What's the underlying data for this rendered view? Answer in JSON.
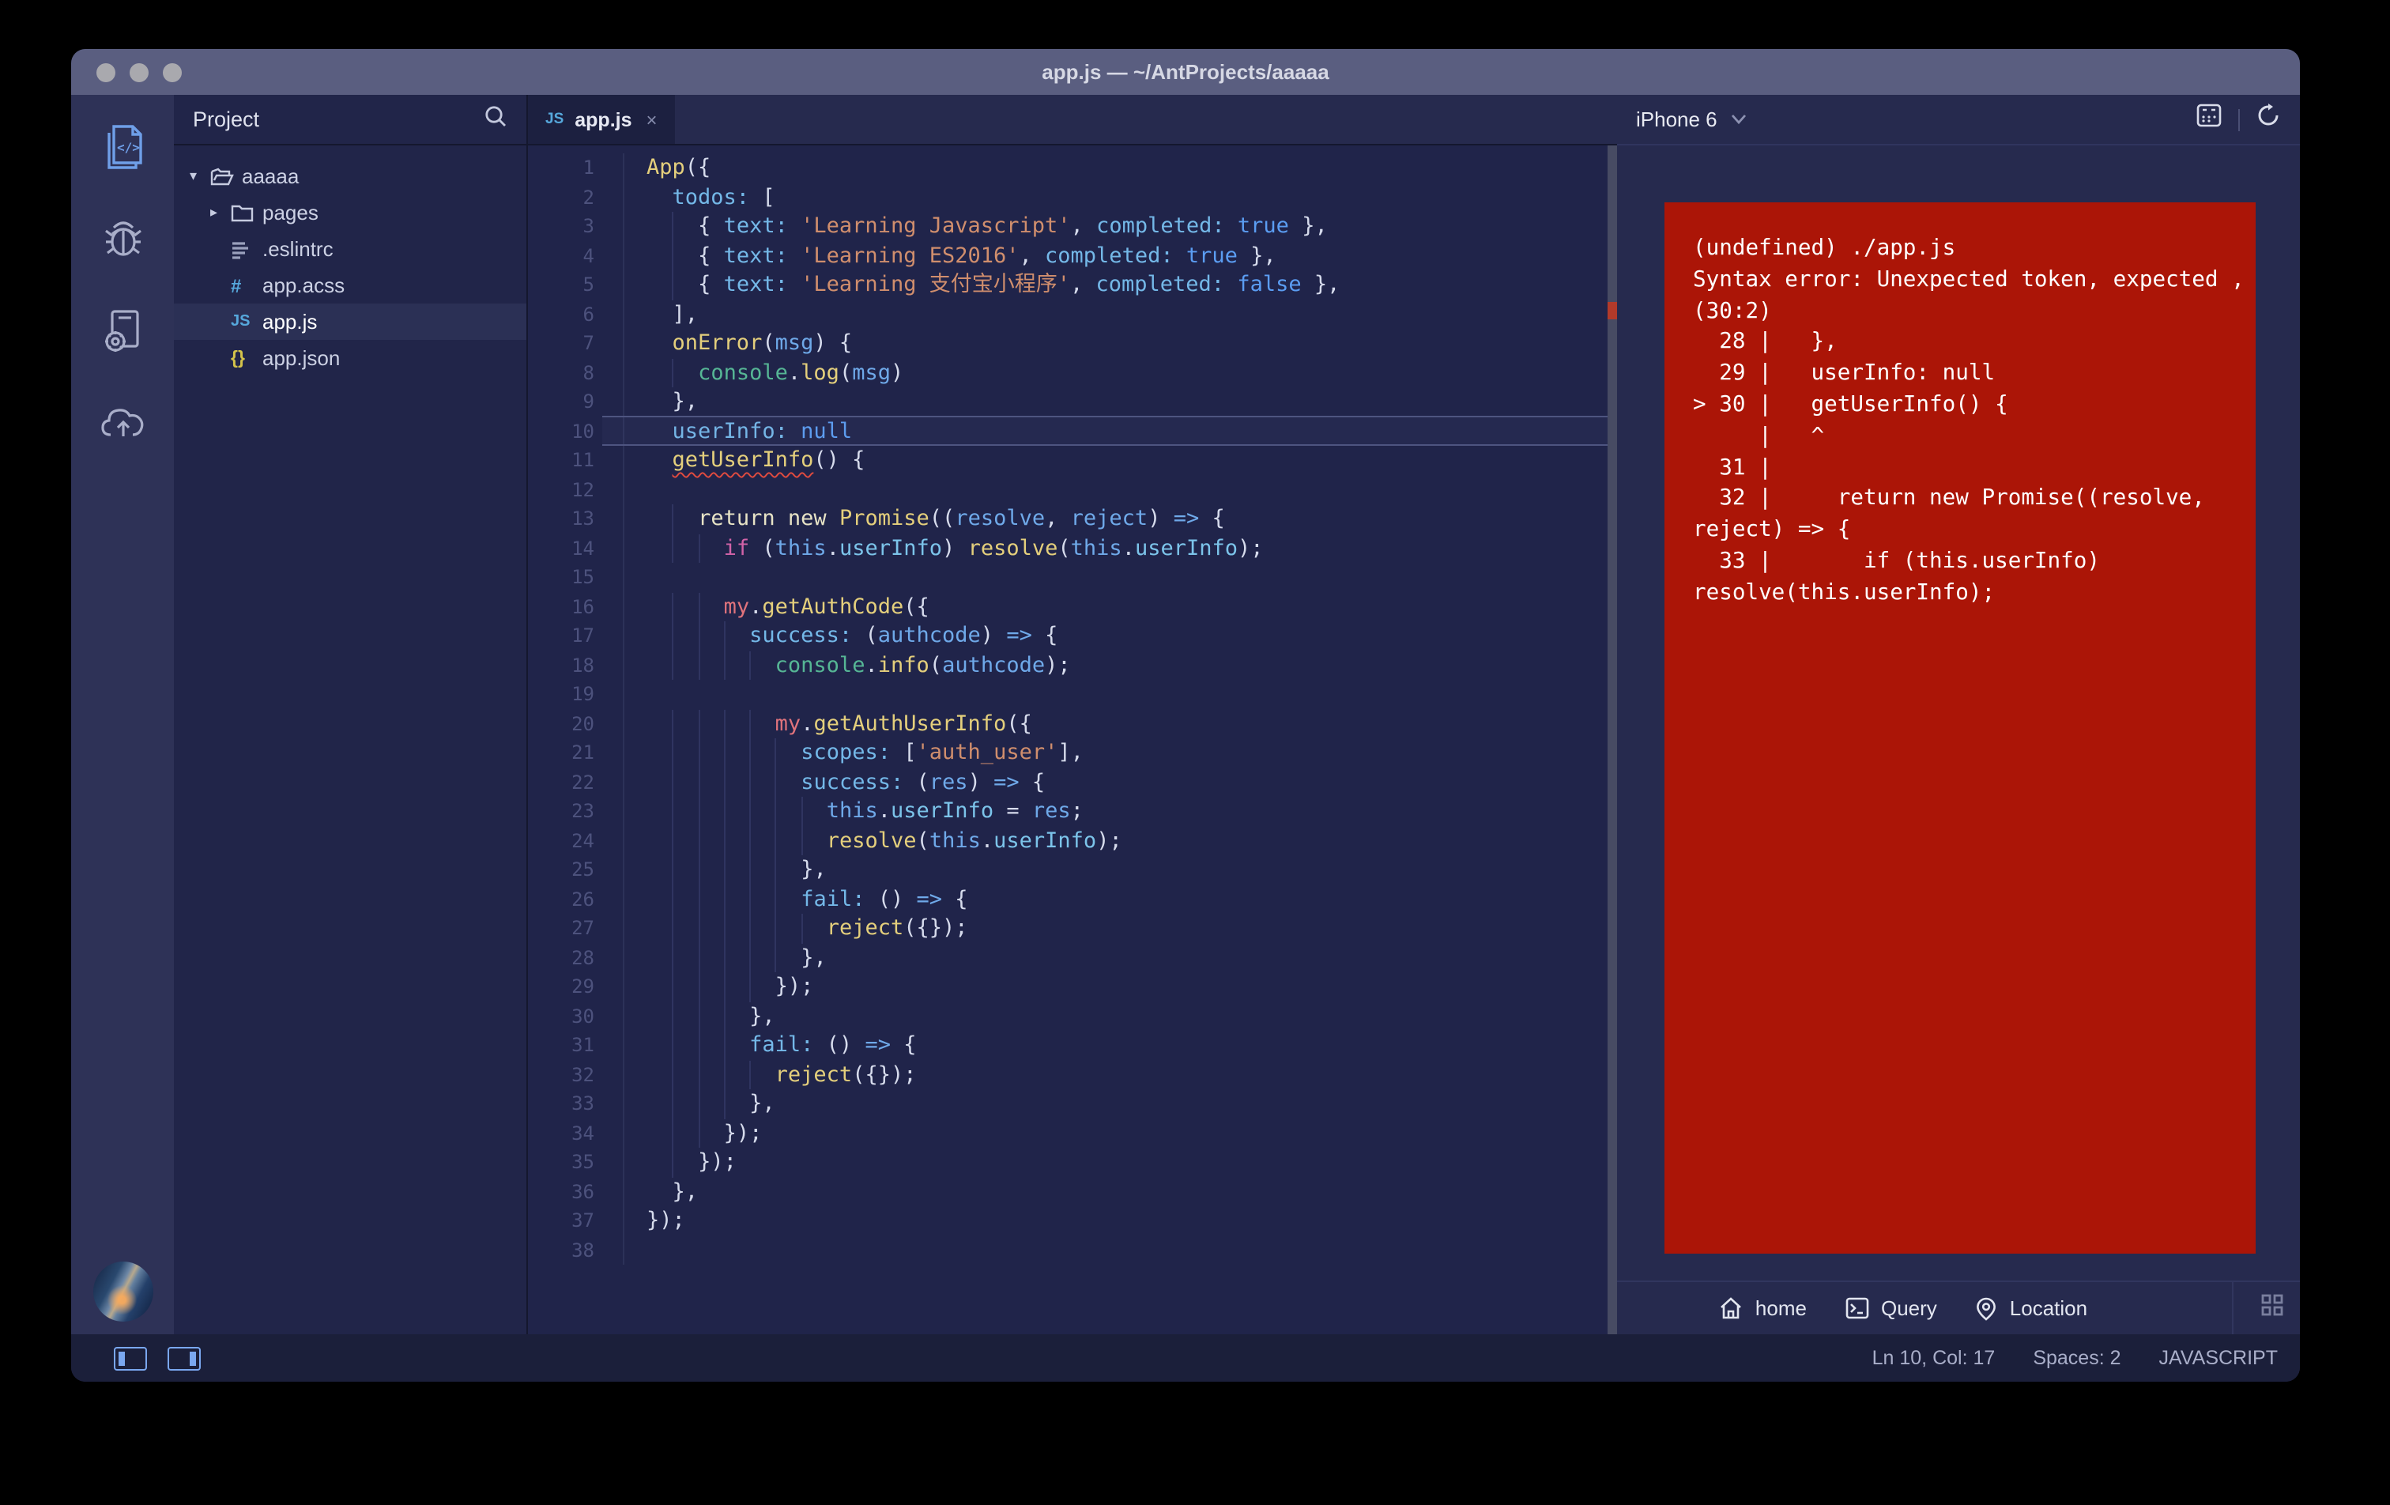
{
  "window": {
    "title": "app.js — ~/AntProjects/aaaaa"
  },
  "colors": {
    "error_screen": "#ab1507",
    "accent_blue": "#6f9fe8",
    "titlebar": "#5a5e80"
  },
  "activity_bar": {
    "icons": [
      {
        "name": "code-file",
        "active": true
      },
      {
        "name": "debug-bug",
        "active": false
      },
      {
        "name": "device-settings",
        "active": false
      },
      {
        "name": "cloud-upload",
        "active": false
      }
    ]
  },
  "sidebar": {
    "header": "Project",
    "items": [
      {
        "icon": "folder-open",
        "caret": "▾",
        "label": "aaaaa",
        "indent": 0,
        "selected": false
      },
      {
        "icon": "folder",
        "caret": "▸",
        "label": "pages",
        "indent": 1,
        "selected": false
      },
      {
        "icon": "eslint",
        "caret": "",
        "label": ".eslintrc",
        "indent": 1,
        "selected": false
      },
      {
        "icon": "acss",
        "caret": "",
        "label": "app.acss",
        "indent": 1,
        "selected": false
      },
      {
        "icon": "js",
        "caret": "",
        "label": "app.js",
        "indent": 1,
        "selected": true
      },
      {
        "icon": "json",
        "caret": "",
        "label": "app.json",
        "indent": 1,
        "selected": false
      }
    ]
  },
  "editor": {
    "tab": {
      "badge": "JS",
      "label": "app.js",
      "close": "×"
    },
    "lines": [
      {
        "n": 1,
        "indent": 0,
        "t": [
          [
            "fn",
            "App"
          ],
          [
            "p",
            "({"
          ]
        ]
      },
      {
        "n": 2,
        "indent": 2,
        "t": [
          [
            "key",
            "todos:"
          ],
          [
            "p",
            " ["
          ]
        ]
      },
      {
        "n": 3,
        "indent": 4,
        "t": [
          [
            "p",
            "{ "
          ],
          [
            "key",
            "text:"
          ],
          [
            "p",
            " "
          ],
          [
            "str",
            "'Learning Javascript'"
          ],
          [
            "p",
            ", "
          ],
          [
            "key",
            "completed:"
          ],
          [
            "p",
            " "
          ],
          [
            "bool",
            "true"
          ],
          [
            "p",
            " },"
          ]
        ]
      },
      {
        "n": 4,
        "indent": 4,
        "t": [
          [
            "p",
            "{ "
          ],
          [
            "key",
            "text:"
          ],
          [
            "p",
            " "
          ],
          [
            "str",
            "'Learning ES2016'"
          ],
          [
            "p",
            ", "
          ],
          [
            "key",
            "completed:"
          ],
          [
            "p",
            " "
          ],
          [
            "bool",
            "true"
          ],
          [
            "p",
            " },"
          ]
        ]
      },
      {
        "n": 5,
        "indent": 4,
        "t": [
          [
            "p",
            "{ "
          ],
          [
            "key",
            "text:"
          ],
          [
            "p",
            " "
          ],
          [
            "str",
            "'Learning 支付宝小程序'"
          ],
          [
            "p",
            ", "
          ],
          [
            "key",
            "completed:"
          ],
          [
            "p",
            " "
          ],
          [
            "bool",
            "false"
          ],
          [
            "p",
            " },"
          ]
        ]
      },
      {
        "n": 6,
        "indent": 2,
        "t": [
          [
            "p",
            "],"
          ]
        ]
      },
      {
        "n": 7,
        "indent": 2,
        "t": [
          [
            "fn",
            "onError"
          ],
          [
            "p",
            "("
          ],
          [
            "var",
            "msg"
          ],
          [
            "p",
            ") {"
          ]
        ]
      },
      {
        "n": 8,
        "indent": 4,
        "t": [
          [
            "obj",
            "console"
          ],
          [
            "p",
            "."
          ],
          [
            "fn",
            "log"
          ],
          [
            "p",
            "("
          ],
          [
            "var",
            "msg"
          ],
          [
            "p",
            ")"
          ]
        ]
      },
      {
        "n": 9,
        "indent": 2,
        "t": [
          [
            "p",
            "},"
          ]
        ]
      },
      {
        "n": 10,
        "indent": 2,
        "current": true,
        "t": [
          [
            "key",
            "userInfo:"
          ],
          [
            "p",
            " "
          ],
          [
            "bool",
            "null"
          ]
        ]
      },
      {
        "n": 11,
        "indent": 2,
        "t": [
          [
            "fnerr",
            "getUserInfo"
          ],
          [
            "p",
            "() {"
          ]
        ]
      },
      {
        "n": 12,
        "indent": 0,
        "t": []
      },
      {
        "n": 13,
        "indent": 4,
        "t": [
          [
            "kw2",
            "return"
          ],
          [
            "p",
            " "
          ],
          [
            "kw2",
            "new"
          ],
          [
            "p",
            " "
          ],
          [
            "fn",
            "Promise"
          ],
          [
            "p",
            "(("
          ],
          [
            "var",
            "resolve"
          ],
          [
            "p",
            ", "
          ],
          [
            "var",
            "reject"
          ],
          [
            "p",
            ") "
          ],
          [
            "arrow",
            "=>"
          ],
          [
            "p",
            " {"
          ]
        ]
      },
      {
        "n": 14,
        "indent": 6,
        "t": [
          [
            "kw",
            "if"
          ],
          [
            "p",
            " ("
          ],
          [
            "var",
            "this"
          ],
          [
            "p",
            "."
          ],
          [
            "prop",
            "userInfo"
          ],
          [
            "p",
            ") "
          ],
          [
            "fn",
            "resolve"
          ],
          [
            "p",
            "("
          ],
          [
            "var",
            "this"
          ],
          [
            "p",
            "."
          ],
          [
            "prop",
            "userInfo"
          ],
          [
            "p",
            ");"
          ]
        ]
      },
      {
        "n": 15,
        "indent": 0,
        "t": []
      },
      {
        "n": 16,
        "indent": 6,
        "t": [
          [
            "my",
            "my"
          ],
          [
            "p",
            "."
          ],
          [
            "fn",
            "getAuthCode"
          ],
          [
            "p",
            "({"
          ]
        ]
      },
      {
        "n": 17,
        "indent": 8,
        "t": [
          [
            "key",
            "success:"
          ],
          [
            "p",
            " ("
          ],
          [
            "var",
            "authcode"
          ],
          [
            "p",
            ") "
          ],
          [
            "arrow",
            "=>"
          ],
          [
            "p",
            " {"
          ]
        ]
      },
      {
        "n": 18,
        "indent": 10,
        "t": [
          [
            "obj",
            "console"
          ],
          [
            "p",
            "."
          ],
          [
            "fn",
            "info"
          ],
          [
            "p",
            "("
          ],
          [
            "var",
            "authcode"
          ],
          [
            "p",
            ");"
          ]
        ]
      },
      {
        "n": 19,
        "indent": 0,
        "t": []
      },
      {
        "n": 20,
        "indent": 10,
        "t": [
          [
            "my",
            "my"
          ],
          [
            "p",
            "."
          ],
          [
            "fn",
            "getAuthUserInfo"
          ],
          [
            "p",
            "({"
          ]
        ]
      },
      {
        "n": 21,
        "indent": 12,
        "t": [
          [
            "key",
            "scopes:"
          ],
          [
            "p",
            " ["
          ],
          [
            "str",
            "'auth_user'"
          ],
          [
            "p",
            "],"
          ]
        ]
      },
      {
        "n": 22,
        "indent": 12,
        "t": [
          [
            "key",
            "success:"
          ],
          [
            "p",
            " ("
          ],
          [
            "var",
            "res"
          ],
          [
            "p",
            ") "
          ],
          [
            "arrow",
            "=>"
          ],
          [
            "p",
            " {"
          ]
        ]
      },
      {
        "n": 23,
        "indent": 14,
        "t": [
          [
            "var",
            "this"
          ],
          [
            "p",
            "."
          ],
          [
            "prop",
            "userInfo"
          ],
          [
            "p",
            " = "
          ],
          [
            "var",
            "res"
          ],
          [
            "p",
            ";"
          ]
        ]
      },
      {
        "n": 24,
        "indent": 14,
        "t": [
          [
            "fn",
            "resolve"
          ],
          [
            "p",
            "("
          ],
          [
            "var",
            "this"
          ],
          [
            "p",
            "."
          ],
          [
            "prop",
            "userInfo"
          ],
          [
            "p",
            ");"
          ]
        ]
      },
      {
        "n": 25,
        "indent": 12,
        "t": [
          [
            "p",
            "},"
          ]
        ]
      },
      {
        "n": 26,
        "indent": 12,
        "t": [
          [
            "key",
            "fail:"
          ],
          [
            "p",
            " () "
          ],
          [
            "arrow",
            "=>"
          ],
          [
            "p",
            " {"
          ]
        ]
      },
      {
        "n": 27,
        "indent": 14,
        "t": [
          [
            "fn",
            "reject"
          ],
          [
            "p",
            "({});"
          ]
        ]
      },
      {
        "n": 28,
        "indent": 12,
        "t": [
          [
            "p",
            "},"
          ]
        ]
      },
      {
        "n": 29,
        "indent": 10,
        "t": [
          [
            "p",
            "});"
          ]
        ]
      },
      {
        "n": 30,
        "indent": 8,
        "t": [
          [
            "p",
            "},"
          ]
        ]
      },
      {
        "n": 31,
        "indent": 8,
        "t": [
          [
            "key",
            "fail:"
          ],
          [
            "p",
            " () "
          ],
          [
            "arrow",
            "=>"
          ],
          [
            "p",
            " {"
          ]
        ]
      },
      {
        "n": 32,
        "indent": 10,
        "t": [
          [
            "fn",
            "reject"
          ],
          [
            "p",
            "({});"
          ]
        ]
      },
      {
        "n": 33,
        "indent": 8,
        "t": [
          [
            "p",
            "},"
          ]
        ]
      },
      {
        "n": 34,
        "indent": 6,
        "t": [
          [
            "p",
            "});"
          ]
        ]
      },
      {
        "n": 35,
        "indent": 4,
        "t": [
          [
            "p",
            "});"
          ]
        ]
      },
      {
        "n": 36,
        "indent": 2,
        "t": [
          [
            "p",
            "},"
          ]
        ]
      },
      {
        "n": 37,
        "indent": 0,
        "t": [
          [
            "p",
            "});"
          ]
        ]
      },
      {
        "n": 38,
        "indent": 0,
        "t": []
      }
    ]
  },
  "simulator": {
    "device": "iPhone 6",
    "error_lines": [
      "(undefined) ./app.js",
      "Syntax error: Unexpected token, expected ,",
      "(30:2)",
      "  28 |   },",
      "  29 |   userInfo: null",
      "> 30 |   getUserInfo() {",
      "     |   ^",
      "  31 |",
      "  32 |     return new Promise((resolve,",
      "reject) => {",
      "  33 |       if (this.userInfo)",
      "resolve(this.userInfo);"
    ],
    "toolbar": {
      "home": "home",
      "query": "Query",
      "location": "Location"
    }
  },
  "status_bar": {
    "cursor": "Ln 10, Col: 17",
    "spaces": "Spaces: 2",
    "language": "JAVASCRIPT"
  }
}
